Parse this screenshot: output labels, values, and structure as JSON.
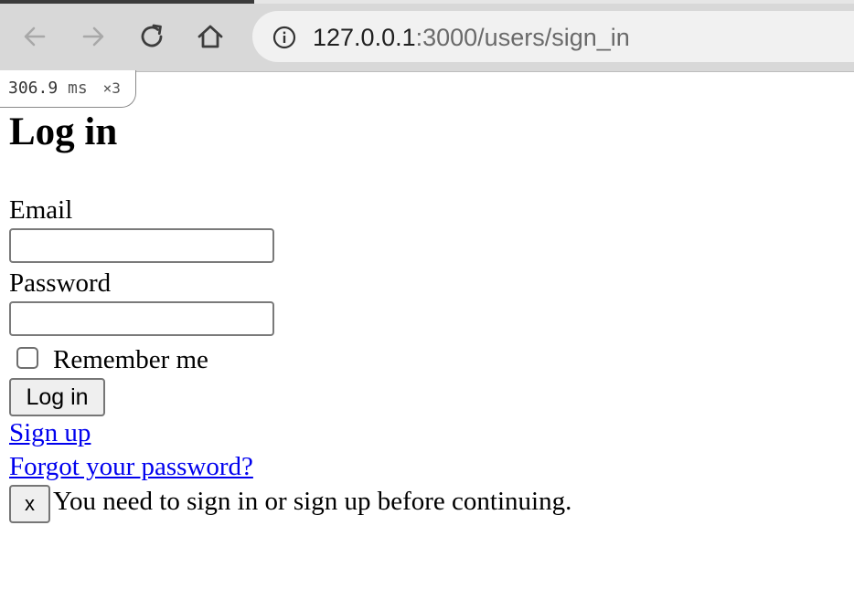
{
  "browser": {
    "url_host": "127.0.0.1",
    "url_rest": ":3000/users/sign_in",
    "icons": {
      "back": "back-arrow-icon",
      "forward": "forward-arrow-icon",
      "reload": "reload-icon",
      "home": "home-icon",
      "info": "site-info-icon"
    }
  },
  "perf_badge": {
    "time": "306.9",
    "unit": "ms",
    "count": "×3"
  },
  "page": {
    "title": "Log in",
    "email_label": "Email",
    "email_value": "",
    "password_label": "Password",
    "password_value": "",
    "remember_label": "Remember me",
    "remember_checked": false,
    "submit_label": "Log in",
    "signup_link": "Sign up",
    "forgot_link": "Forgot your password?",
    "flash_close": "x",
    "flash_message": "You need to sign in or sign up before continuing."
  },
  "colors": {
    "link": "#0000ee",
    "toolbar": "#d8d8d8",
    "omnibox": "#f1f1f1"
  }
}
